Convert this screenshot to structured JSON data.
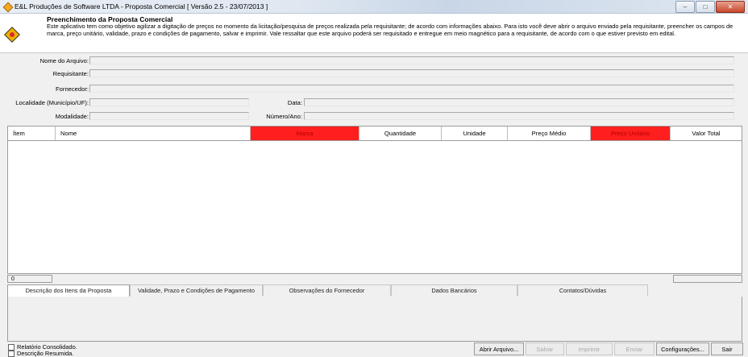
{
  "window": {
    "title": "E&L Produções de Software LTDA - Proposta Comercial [ Versão 2.5 - 23/07/2013 ]"
  },
  "header": {
    "title": "Preenchimento da Proposta Comercial",
    "description": "Este aplicativo tem como objetivo agilizar a digitação de preços no momento da licitação/pesquisa de preços realizada pela requisitante; de acordo com informações abaixo. Para isto você deve abrir o arquivo enviado pela requisitante, preencher os campos de marca, preço unitário, validade, prazo e condições de pagamento, salvar e imprimir. Vale ressaltar que este arquivo poderá ser requisitado e entregue em meio magnético para a requisitante, de acordo com o que estiver previsto em edital."
  },
  "form": {
    "nome_arquivo_label": "Nome do Arquivo:",
    "requisitante_label": "Requisitante:",
    "fornecedor_label": "Fornecedor:",
    "localidade_label": "Localidade (Município/UF):",
    "modalidade_label": "Modalidade:",
    "data_label": "Data:",
    "numero_ano_label": "Número/Ano:"
  },
  "grid": {
    "columns": [
      "Ítem",
      "Nome",
      "Marca",
      "Quantidade",
      "Unidade",
      "Preço Médio",
      "Preço Unitário",
      "Valor Total"
    ],
    "highlight_color": "#ff1f1f"
  },
  "status": {
    "count": "0"
  },
  "tabs": [
    "Descrição dos Itens da Proposta",
    "Validade, Prazo e Condições de Pagamento",
    "Observações do Fornecedor",
    "Dados Bancários",
    "Contatos/Dúvidas"
  ],
  "checkboxes": {
    "relatorio": "Relatório Consolidado.",
    "descricao": "Descrição Resumida."
  },
  "buttons": {
    "abrir": "Abrir Arquivo...",
    "salvar": "Salvar",
    "imprimir": "Imprimir",
    "enviar": "Enviar",
    "configuracoes": "Configurações...",
    "sair": "Sair"
  }
}
